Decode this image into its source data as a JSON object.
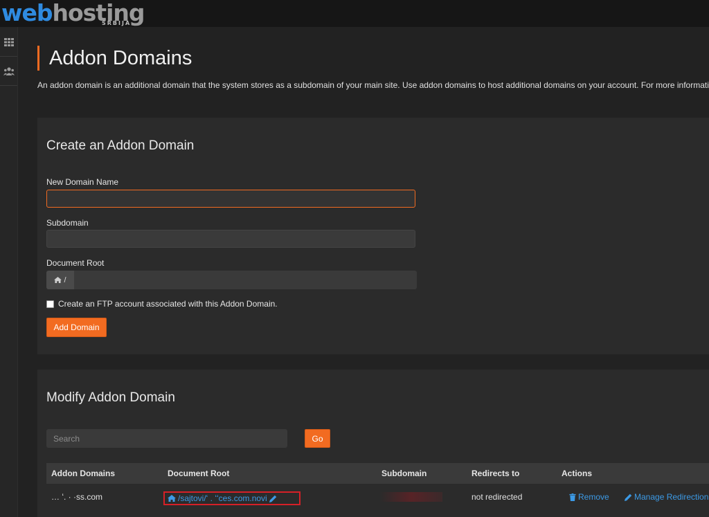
{
  "brand": {
    "web": "web",
    "hosting": "hosting",
    "country": "SRBIJA"
  },
  "page": {
    "title": "Addon Domains",
    "description": "An addon domain is an additional domain that the system stores as a subdomain of your main site. Use addon domains to host additional domains on your account. For more information, rea"
  },
  "create": {
    "title": "Create an Addon Domain",
    "new_domain_label": "New Domain Name",
    "subdomain_label": "Subdomain",
    "docroot_label": "Document Root",
    "docroot_prefix": "/",
    "ftp_checkbox_label": "Create an FTP account associated with this Addon Domain.",
    "add_button": "Add Domain"
  },
  "modify": {
    "title": "Modify Addon Domain",
    "search_placeholder": "Search",
    "go_button": "Go",
    "columns": [
      "Addon Domains",
      "Document Root",
      "Subdomain",
      "Redirects to",
      "Actions"
    ],
    "rows": [
      {
        "domain": "… ʻ. · ·ss.com",
        "document_root": "/sajtovi/ʻ .  ʻʻces.com.novi",
        "subdomain": "",
        "redirects_to": "not redirected",
        "remove_label": "Remove",
        "manage_label": "Manage Redirection"
      }
    ]
  },
  "colors": {
    "accent": "#f26b21",
    "link": "#3c9ae6",
    "highlight_border": "#d62027"
  },
  "icons": [
    "grid-icon",
    "users-icon",
    "home-icon",
    "pencil-icon",
    "trash-icon"
  ]
}
